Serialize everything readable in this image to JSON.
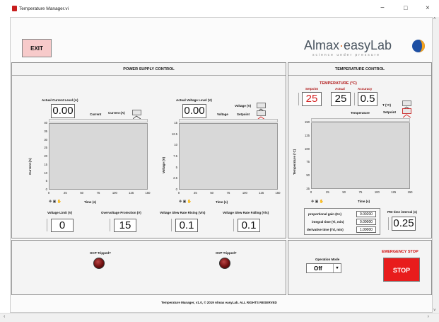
{
  "window": {
    "title": "Temperature Manager.vi",
    "min": "−",
    "max": "□",
    "close": "×"
  },
  "exit_label": "EXIT",
  "logo": {
    "main_a": "Almax",
    "dot": "·",
    "main_b": "easyLab",
    "tagline": "science under pressure"
  },
  "power_panel": {
    "title": "POWER SUPPLY CONTROL",
    "current": {
      "label": "Actual Current Level (A)",
      "value": "0.00",
      "legend_label": "Current",
      "legend_series": "Current (A)",
      "y_ticks": [
        "40",
        "35",
        "30",
        "25",
        "20",
        "15",
        "10",
        "5",
        "0"
      ],
      "x_ticks": [
        "0",
        "25",
        "50",
        "75",
        "100",
        "125",
        "150"
      ],
      "ylabel": "Current (A)",
      "xlabel": "Time (s)"
    },
    "voltage": {
      "label": "Actual Voltage Level (V)",
      "value": "0.00",
      "legend_label": "Voltage",
      "legend_series_1": "Voltage (V)",
      "legend_series_2": "Setpoint",
      "y_ticks": [
        "15",
        "12.5",
        "10",
        "7.5",
        "5",
        "2.5",
        "0"
      ],
      "x_ticks": [
        "0",
        "25",
        "50",
        "75",
        "100",
        "125",
        "150"
      ],
      "ylabel": "Voltage (V)",
      "xlabel": "Time (s)"
    },
    "controls": [
      {
        "label": "Voltage Limit (V)",
        "value": "0"
      },
      {
        "label": "Overvoltage Protection (V)",
        "value": "15"
      },
      {
        "label": "Voltage Slew Rate Rising (V/s)",
        "value": "0.1"
      },
      {
        "label": "Voltage Slew Rate Falling (V/s)",
        "value": "0.1"
      }
    ]
  },
  "temp_panel": {
    "title": "TEMPERATURE CONTROL",
    "subtitle": "TEMPERATURE (°C)",
    "setpoint": {
      "label": "Setpoint",
      "value": "25"
    },
    "actual": {
      "label": "Actual",
      "value": "25"
    },
    "accuracy": {
      "label": "Accuracy",
      "value": "0.5"
    },
    "legend_series_1": "T (°C)",
    "legend_series_2": "Setpoint",
    "legend_label": "Temperature",
    "y_ticks": [
      "150",
      "125",
      "100",
      "75",
      "50",
      "25"
    ],
    "x_ticks": [
      "0",
      "25",
      "50",
      "75",
      "100",
      "125",
      "150"
    ],
    "ylabel": "Temperature (°C)",
    "xlabel": "Time (s)",
    "pid": [
      {
        "label": "proportional gain (Kc)",
        "value": "0.00200"
      },
      {
        "label": "integral time (Ti, min)",
        "value": "0.00000"
      },
      {
        "label": "derivative time (Td, min)",
        "value": "1.00000"
      }
    ],
    "pid_interval": {
      "label": "PID time interval (s)",
      "value": "0.25"
    }
  },
  "ocp": "OCP Tripped?",
  "ovp": "OVP Tripped?",
  "operation": {
    "label": "Operation Mode",
    "value": "Off"
  },
  "emergency": {
    "label": "EMERGENCY STOP",
    "button": "STOP"
  },
  "footer": "Temperature Manager, v1.0, © 2019 Almax easyLab. ALL RIGHTS RESERVED",
  "colors": {
    "stop_red": "#e81c1c",
    "emergency_text": "#d11010",
    "led_off": "#7a1515",
    "setpoint_red": "#d42020"
  }
}
